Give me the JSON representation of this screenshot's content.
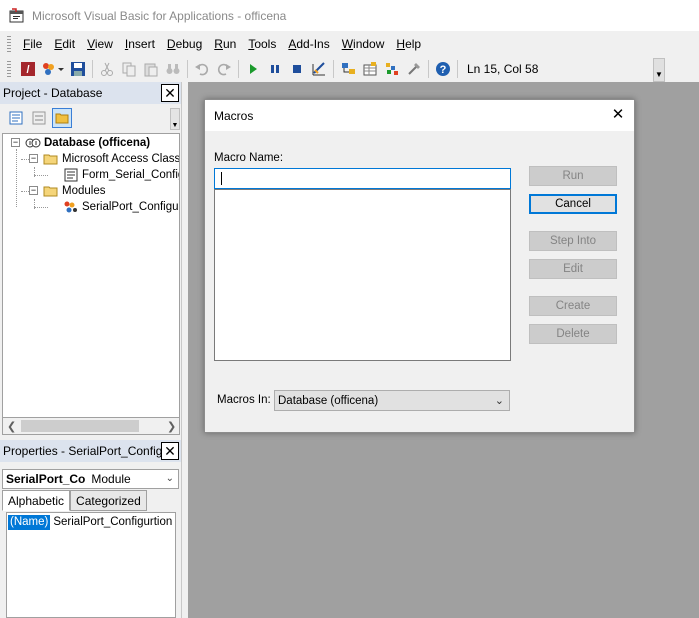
{
  "window": {
    "title": "Microsoft Visual Basic for Applications - officena"
  },
  "menu": {
    "items": [
      {
        "label": "File",
        "mnemonic": "F",
        "rest": "ile"
      },
      {
        "label": "Edit",
        "mnemonic": "E",
        "rest": "dit"
      },
      {
        "label": "View",
        "mnemonic": "V",
        "rest": "iew"
      },
      {
        "label": "Insert",
        "mnemonic": "I",
        "rest": "nsert"
      },
      {
        "label": "Debug",
        "mnemonic": "D",
        "rest": "ebug"
      },
      {
        "label": "Run",
        "mnemonic": "R",
        "rest": "un"
      },
      {
        "label": "Tools",
        "mnemonic": "T",
        "rest": "ools"
      },
      {
        "label": "Add-Ins",
        "mnemonic": "A",
        "rest": "dd-Ins"
      },
      {
        "label": "Window",
        "mnemonic": "W",
        "rest": "indow"
      },
      {
        "label": "Help",
        "mnemonic": "H",
        "rest": "elp"
      }
    ]
  },
  "toolbar": {
    "status": "Ln 15, Col 58",
    "icons": [
      "view-access-icon",
      "insert-module-icon",
      "save-icon",
      "cut-icon",
      "copy-icon",
      "paste-icon",
      "find-icon",
      "undo-icon",
      "redo-icon",
      "run-icon",
      "break-icon",
      "reset-icon",
      "design-mode-icon",
      "project-explorer-icon",
      "properties-icon",
      "object-browser-icon",
      "toolbox-icon",
      "help-icon"
    ]
  },
  "project": {
    "title": "Project - Database",
    "tree": {
      "root": "Database (officena)",
      "folder1": "Microsoft Access Class O",
      "item1": "Form_Serial_Config",
      "folder2": "Modules",
      "item2": "SerialPort_Configurt"
    }
  },
  "properties": {
    "title": "Properties - SerialPort_Configu",
    "object_name": "SerialPort_Co",
    "object_type": "Module",
    "tabs": [
      "Alphabetic",
      "Categorized"
    ],
    "row": {
      "name": "(Name)",
      "value": "SerialPort_Configurtion"
    }
  },
  "dialog": {
    "title": "Macros",
    "macro_name_label": "Macro Name:",
    "macro_name_value": "",
    "macros_in_label": "Macros In:",
    "macros_in_value": "Database (officena)",
    "buttons": {
      "run": "Run",
      "cancel": "Cancel",
      "step_into": "Step Into",
      "edit": "Edit",
      "create": "Create",
      "delete": "Delete"
    }
  },
  "colors": {
    "accent": "#0078d7",
    "panel_title_bg": "#dce3ee",
    "workspace_bg": "#a0a0a0",
    "disabled_text": "#848484"
  }
}
